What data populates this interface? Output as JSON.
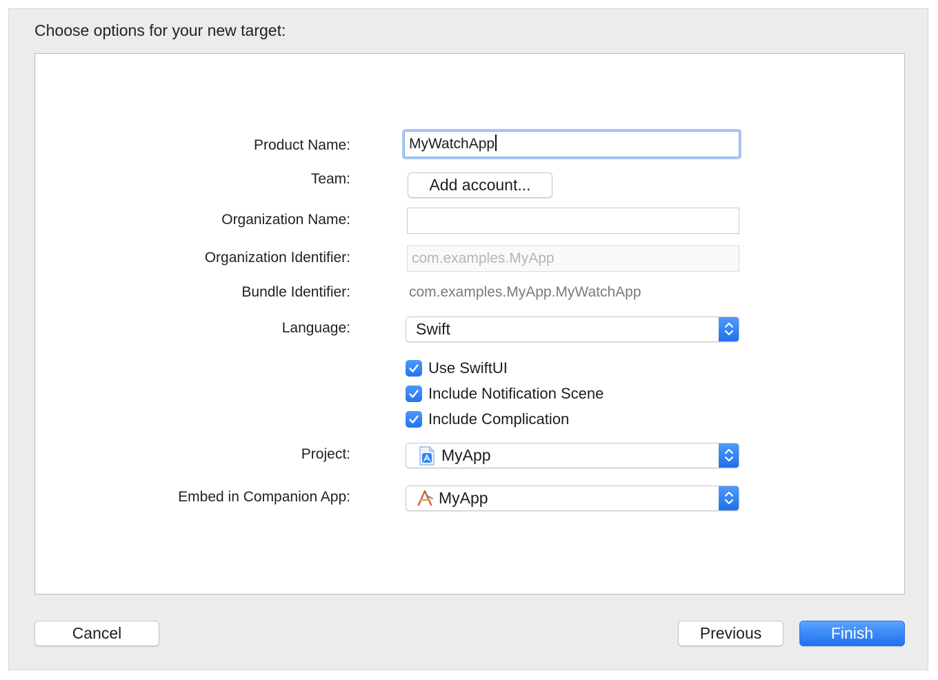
{
  "dialog": {
    "title": "Choose options for your new target:"
  },
  "form": {
    "product_name": {
      "label": "Product Name:",
      "value": "MyWatchApp"
    },
    "team": {
      "label": "Team:",
      "button_label": "Add account..."
    },
    "organization_name": {
      "label": "Organization Name:",
      "value": ""
    },
    "organization_identifier": {
      "label": "Organization Identifier:",
      "placeholder": "com.examples.MyApp"
    },
    "bundle_identifier": {
      "label": "Bundle Identifier:",
      "value": "com.examples.MyApp.MyWatchApp"
    },
    "language": {
      "label": "Language:",
      "selected": "Swift"
    },
    "options": [
      {
        "label": "Use SwiftUI",
        "checked": true
      },
      {
        "label": "Include Notification Scene",
        "checked": true
      },
      {
        "label": "Include Complication",
        "checked": true
      }
    ],
    "project": {
      "label": "Project:",
      "selected": "MyApp",
      "icon": "xcode-project-icon"
    },
    "companion_app": {
      "label": "Embed in Companion App:",
      "selected": "MyApp",
      "icon": "app-target-icon"
    }
  },
  "footer": {
    "cancel_label": "Cancel",
    "previous_label": "Previous",
    "finish_label": "Finish"
  },
  "colors": {
    "accent": "#2374ee",
    "sheet_background": "#ececec",
    "focus_ring": "#a8c8f2"
  }
}
